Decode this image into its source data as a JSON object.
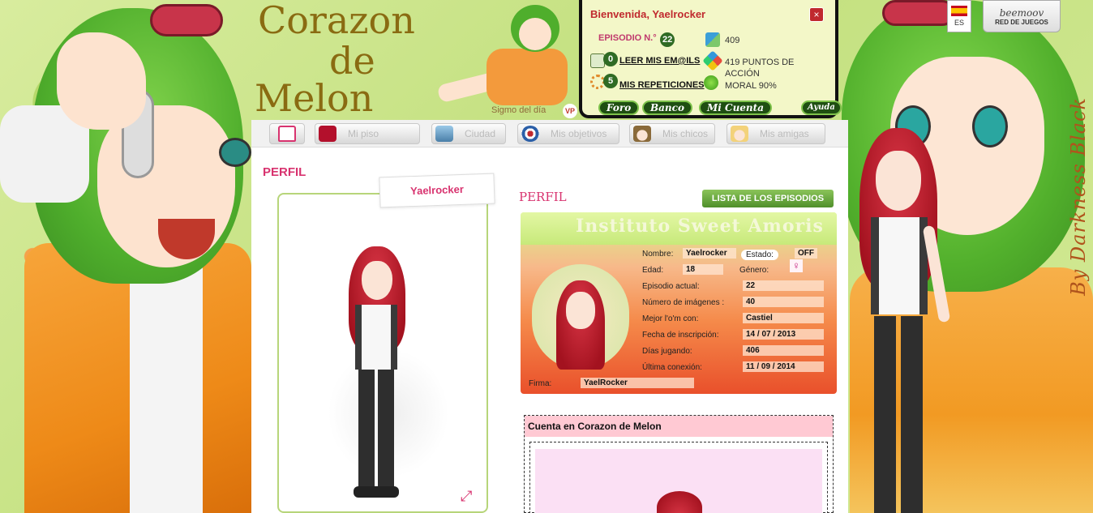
{
  "site": {
    "title_line1": "Corazon",
    "title_line2": "de",
    "title_line3": "Melon",
    "vip_text": "Sigmo del día",
    "vip_badge": "VP",
    "watermark": "By Darkness Black"
  },
  "user_panel": {
    "welcome": "Bienvenida, Yaelrocker",
    "close": "×",
    "episode_label": "EPISODIO N.°",
    "episode_number": "22",
    "dollars": "409",
    "emails_count": "0",
    "emails_link": "LEER MIS EM@ILS",
    "action_points": "419 PUNTOS DE ACCIÓN",
    "repetitions_count": "5",
    "repetitions_link": "MIS REPETICIONES",
    "moral": "MORAL 90%",
    "buttons": [
      "Foro",
      "Banco",
      "Mi Cuenta"
    ],
    "help": "Ayuda"
  },
  "lang": {
    "code": "ES"
  },
  "partner": {
    "logo": "beemoov",
    "subtitle": "RED DE JUEGOS"
  },
  "nav": {
    "items": [
      {
        "label": ""
      },
      {
        "label": "Mi piso"
      },
      {
        "label": "Ciudad"
      },
      {
        "label": "Mis objetivos"
      },
      {
        "label": "Mis chicos"
      },
      {
        "label": "Mis amigas"
      }
    ]
  },
  "profile": {
    "heading": "PERFIL",
    "username": "Yaelrocker",
    "heading2": "PERFIL",
    "episodes_button": "LISTA DE LOS EPISODIOS",
    "expand_icon": "⤢"
  },
  "idcard": {
    "banner": "Instituto Sweet Amoris",
    "fields": {
      "nombre_label": "Nombre:",
      "nombre": "Yaelrocker",
      "estado_label": "Estado:",
      "estado": "OFF",
      "edad_label": "Edad:",
      "edad": "18",
      "genero_label": "Género:",
      "genero_icon": "♀",
      "episodio_label": "Episodio actual:",
      "episodio": "22",
      "imagenes_label": "Número de imágenes :",
      "imagenes": "40",
      "mejor_label": "Mejor l'o'm con:",
      "mejor": "Castiel",
      "inscripcion_label": "Fecha de inscripción:",
      "inscripcion": "14 / 07 / 2013",
      "dias_label": "Días jugando:",
      "dias": "406",
      "conexion_label": "Última conexión:",
      "conexion": "11 / 09 / 2014",
      "firma_label": "Firma:",
      "firma": "YaelRocker"
    }
  },
  "account": {
    "heading": "Cuenta en Corazon de Melon"
  },
  "colors": {
    "accent": "#d8336f",
    "green_btn": "#4f8f2a",
    "panel_border": "#111111",
    "welcome": "#c0292e"
  }
}
